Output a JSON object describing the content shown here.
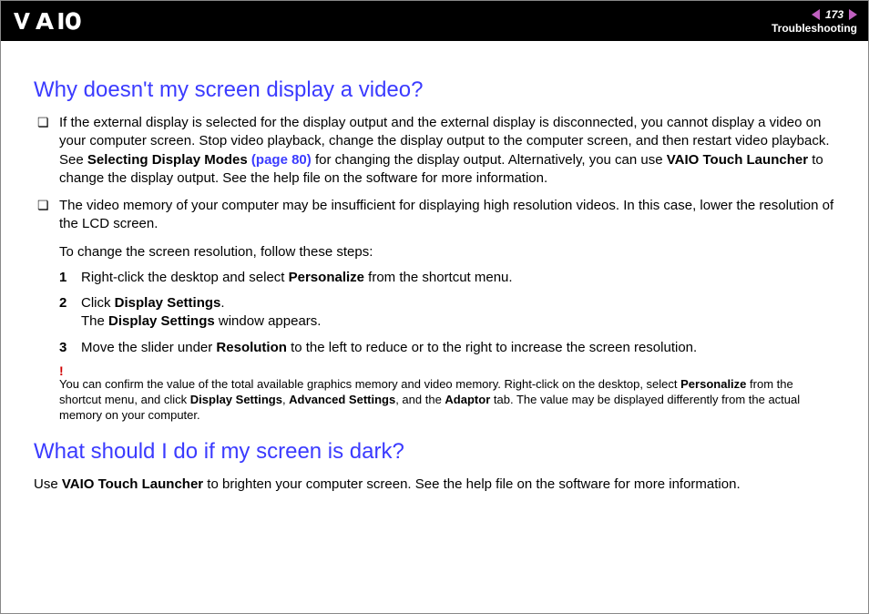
{
  "header": {
    "page_number": "173",
    "section": "Troubleshooting"
  },
  "q1": {
    "title": "Why doesn't my screen display a video?",
    "bullet1_a": "If the external display is selected for the display output and the external display is disconnected, you cannot display a video on your computer screen. Stop video playback, change the display output to the computer screen, and then restart video playback. See ",
    "bullet1_b": "Selecting Display Modes ",
    "bullet1_link": "(page 80)",
    "bullet1_c": " for changing the display output. Alternatively, you can use ",
    "bullet1_d": "VAIO Touch Launcher",
    "bullet1_e": " to change the display output. See the help file on the software for more information.",
    "bullet2": "The video memory of your computer may be insufficient for displaying high resolution videos. In this case, lower the resolution of the LCD screen.",
    "sub_intro": "To change the screen resolution, follow these steps:",
    "step1_a": "Right-click the desktop and select ",
    "step1_b": "Personalize",
    "step1_c": " from the shortcut menu.",
    "step2_a": "Click ",
    "step2_b": "Display Settings",
    "step2_c": ".",
    "step2_d": "The ",
    "step2_e": "Display Settings",
    "step2_f": " window appears.",
    "step3_a": "Move the slider under ",
    "step3_b": "Resolution",
    "step3_c": " to the left to reduce or to the right to increase the screen resolution.",
    "bang": "!",
    "note_a": "You can confirm the value of the total available graphics memory and video memory. Right-click on the desktop, select ",
    "note_b": "Personalize",
    "note_c": " from the shortcut menu, and click ",
    "note_d": "Display Settings",
    "note_e": ", ",
    "note_f": "Advanced Settings",
    "note_g": ", and the ",
    "note_h": "Adaptor",
    "note_i": " tab. The value may be displayed differently from the actual memory on your computer."
  },
  "q2": {
    "title": "What should I do if my screen is dark?",
    "p_a": "Use ",
    "p_b": "VAIO Touch Launcher",
    "p_c": " to brighten your computer screen. See the help file on the software for more information."
  }
}
